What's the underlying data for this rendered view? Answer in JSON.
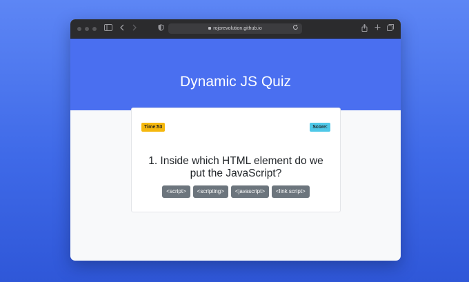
{
  "browser": {
    "url": "rojorevolution.github.io"
  },
  "header": {
    "title": "Dynamic JS Quiz"
  },
  "quiz": {
    "time_label": "Time:53",
    "score_label": "Score:",
    "question": "1. Inside which HTML element do we put the JavaScript?",
    "answers": [
      {
        "label": "<script>"
      },
      {
        "label": "<scripting>"
      },
      {
        "label": "<javascript>"
      },
      {
        "label": "<link script>"
      }
    ]
  },
  "colors": {
    "header_bg": "#4a6ff0",
    "time_badge": "#f5b80e",
    "score_badge": "#4fc8e8",
    "answer_button": "#6c757d"
  }
}
